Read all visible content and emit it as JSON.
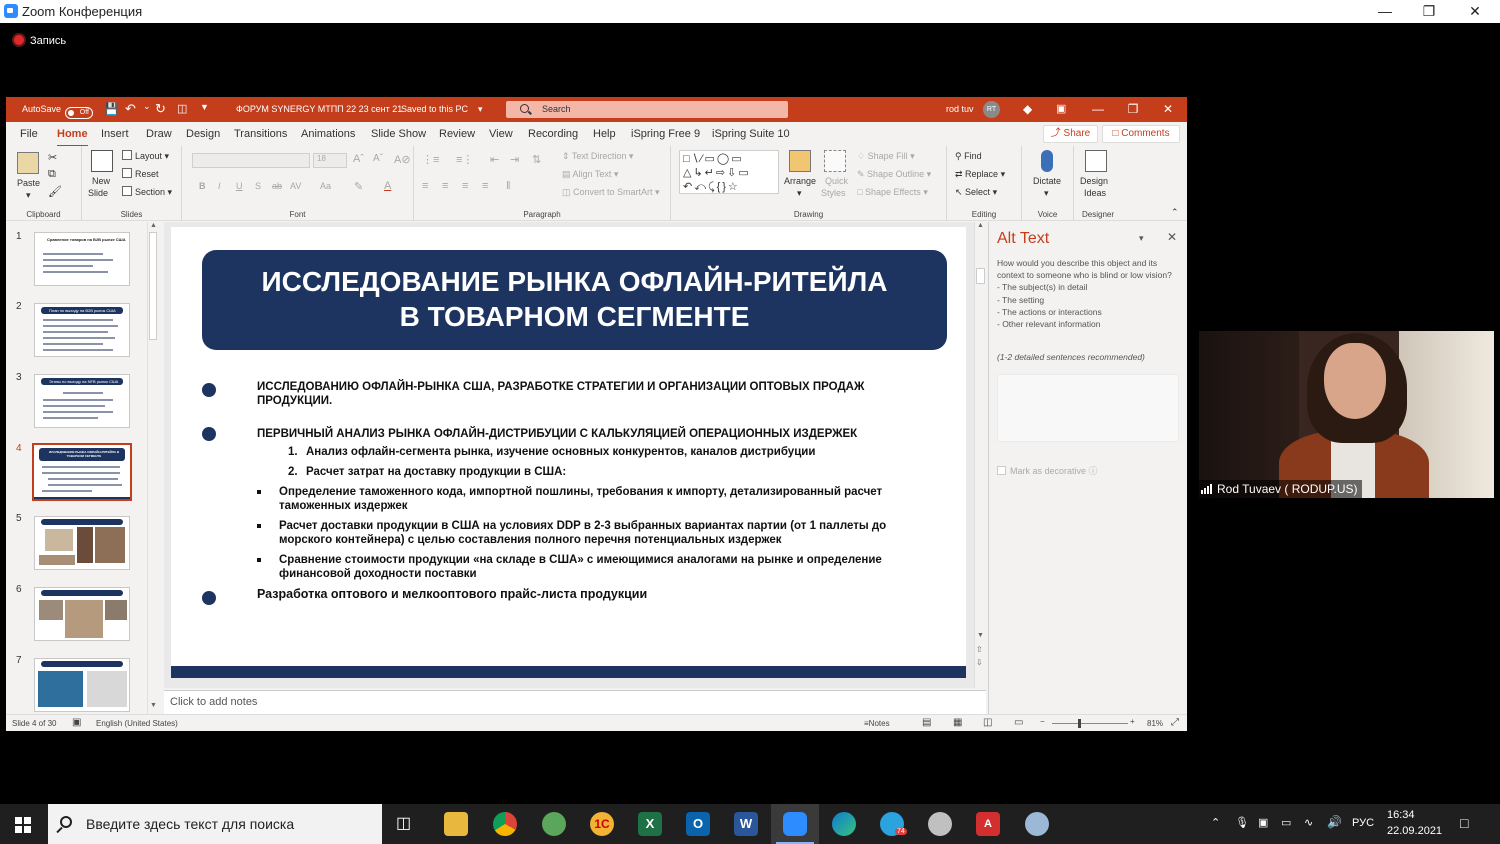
{
  "zoom": {
    "window_title": "Zoom Конференция",
    "recording_label": "Запись"
  },
  "ppt": {
    "autosave_label": "AutoSave",
    "autosave_state": "Off",
    "doc_title": "ФОРУМ SYNERGY МТПП 22 23 сент 21",
    "saved_status": "Saved to this PC",
    "search_placeholder": "Search",
    "user_name": "rod tuv",
    "user_initials": "RT",
    "menu": [
      "File",
      "Home",
      "Insert",
      "Draw",
      "Design",
      "Transitions",
      "Animations",
      "Slide Show",
      "Review",
      "View",
      "Recording",
      "Help",
      "iSpring Free 9",
      "iSpring Suite 10"
    ],
    "active_menu": "Home",
    "share_label": "Share",
    "comments_label": "Comments",
    "ribbon": {
      "clipboard": {
        "paste": "Paste",
        "label": "Clipboard"
      },
      "slides": {
        "new_slide_1": "New",
        "new_slide_2": "Slide",
        "layout": "Layout",
        "reset": "Reset",
        "section": "Section",
        "label": "Slides"
      },
      "font": {
        "font_size": "18",
        "label": "Font",
        "bold": "B",
        "italic": "I",
        "underline": "U",
        "strike": "S",
        "spacing": "AV",
        "case": "Aa"
      },
      "paragraph": {
        "text_direction": "Text Direction",
        "align_text": "Align Text",
        "convert_smartart": "Convert to SmartArt",
        "label": "Paragraph"
      },
      "drawing": {
        "arrange": "Arrange",
        "quick_styles_1": "Quick",
        "quick_styles_2": "Styles",
        "shape_fill": "Shape Fill",
        "shape_outline": "Shape Outline",
        "shape_effects": "Shape Effects",
        "label": "Drawing"
      },
      "editing": {
        "find": "Find",
        "replace": "Replace",
        "select": "Select",
        "label": "Editing"
      },
      "voice": {
        "dictate": "Dictate",
        "label": "Voice"
      },
      "designer": {
        "design_ideas_1": "Design",
        "design_ideas_2": "Ideas",
        "label": "Designer"
      }
    },
    "thumbnails": [
      "1",
      "2",
      "3",
      "4",
      "5",
      "6",
      "7"
    ],
    "thumbnail_titles": [
      "Сравнение товаров на B2B рынке США",
      "План по выходу на B2B рынок США",
      "Этапы по выходу на NFB рынок США",
      "ИССЛЕДОВАНИЕ РЫНКА ОФЛАЙН-РИТЕЙЛА В ТОВАРНОМ СЕГМЕНТЕ"
    ],
    "selected_slide": 4,
    "notes_placeholder": "Click to add notes",
    "status": {
      "slide_info": "Slide 4 of 30",
      "language": "English (United States)",
      "notes_btn": "Notes",
      "zoom_pct": "81%"
    }
  },
  "slide": {
    "title_line1": "ИССЛЕДОВАНИЕ РЫНКА ОФЛАЙН-РИТЕЙЛА",
    "title_line2": "В ТОВАРНОМ СЕГМЕНТЕ",
    "bullet1": "ИССЛЕДОВАНИЮ ОФЛАЙН-РЫНКА США, РАЗРАБОТКЕ СТРАТЕГИИ И ОРГАНИЗАЦИИ ОПТОВЫХ ПРОДАЖ ПРОДУКЦИИ.",
    "bullet2": "ПЕРВИЧНЫЙ АНАЛИЗ РЫНКА ОФЛАЙН-ДИСТРИБУЦИИ С КАЛЬКУЛЯЦИЕЙ ОПЕРАЦИОННЫХ ИЗДЕРЖЕК",
    "num1": "1.",
    "num1_text": "Анализ офлайн-сегмента рынка, изучение основных конкурентов, каналов дистрибуции",
    "num2": "2.",
    "num2_text": "Расчет затрат на доставку продукции в США:",
    "sub1": "Определение таможенного кода, импортной пошлины, требования к импорту, детализированный расчет таможенных издержек",
    "sub2": "Расчет доставки продукции в США на условиях DDP в 2-3 выбранных вариантах партии (от 1 паллеты до морского контейнера) с целью составления полного перечня потенциальных издержек",
    "sub3": "Сравнение стоимости продукции «на складе в США» с имеющимися аналогами на рынке и определение финансовой доходности поставки",
    "bullet3": "Разработка оптового и мелкооптового прайс-листа продукции"
  },
  "alt_text": {
    "heading": "Alt Text",
    "description": "How would you describe this object and its context to someone who is blind or low vision?",
    "items": [
      "- The subject(s) in detail",
      "- The setting",
      "- The actions or interactions",
      "- Other relevant information"
    ],
    "recommendation": "(1-2 detailed sentences recommended)",
    "decorative_label": "Mark as decorative"
  },
  "video": {
    "participant_name": "Rod Tuvaev ( RODUP.US)"
  },
  "taskbar": {
    "search_placeholder": "Введите здесь текст для поиска",
    "language": "РУС",
    "time": "16:34",
    "date": "22.09.2021",
    "telegram_badge": "74"
  },
  "colors": {
    "ppt_accent": "#c43e1c",
    "slide_navy": "#1d3461",
    "zoom_blue": "#2d8cff"
  }
}
